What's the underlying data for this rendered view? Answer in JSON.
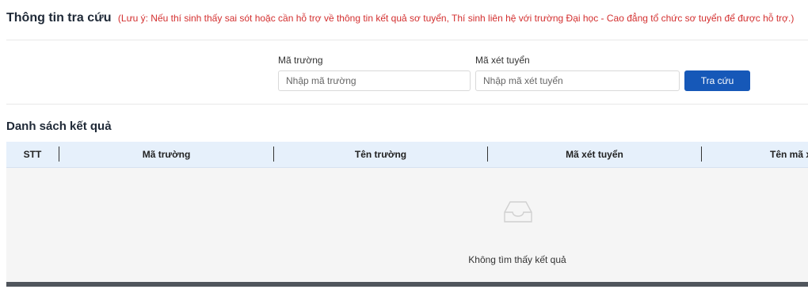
{
  "header": {
    "title": "Thông tin tra cứu",
    "note": "(Lưu ý: Nếu thí sinh thấy sai sót hoặc cần hỗ trợ về thông tin kết quả sơ tuyển, Thí sinh liên hệ với trường Đại học - Cao đẳng tổ chức sơ tuyển để được hỗ trợ.)"
  },
  "search_form": {
    "school_code": {
      "label": "Mã trường",
      "placeholder": "Nhập mã trường",
      "value": ""
    },
    "admission_code": {
      "label": "Mã xét tuyển",
      "placeholder": "Nhập mã xét tuyển",
      "value": ""
    },
    "submit_label": "Tra cứu"
  },
  "results": {
    "title": "Danh sách kết quả",
    "columns": [
      "STT",
      "Mã trường",
      "Tên trường",
      "Mã xét tuyển",
      "Tên mã xét tuyển"
    ],
    "empty_text": "Không tìm thấy kết quả",
    "empty_icon": "inbox-icon"
  },
  "colors": {
    "accent": "#1658b8",
    "note": "#d32f2f",
    "table_header_bg": "#e6f0fb",
    "table_body_bg": "#f5f5f5"
  }
}
